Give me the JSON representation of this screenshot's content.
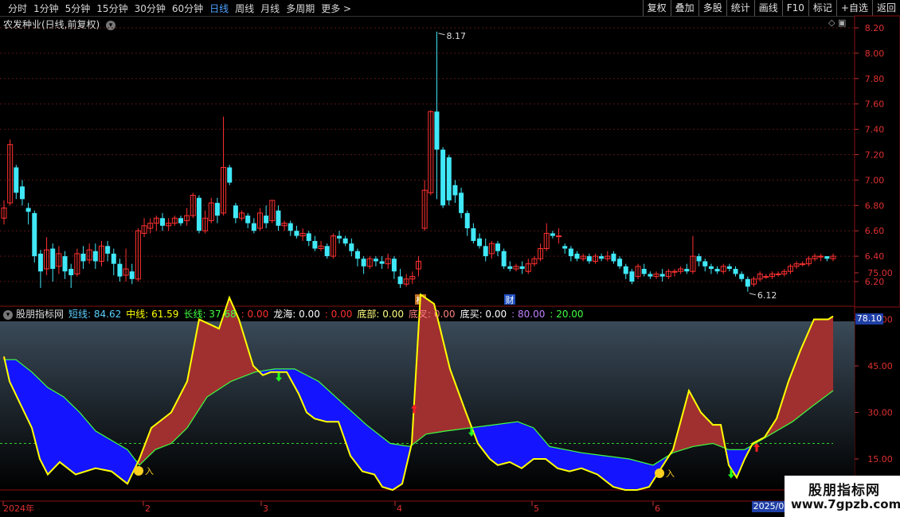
{
  "toolbar": {
    "periods": [
      "分时",
      "1分钟",
      "5分钟",
      "15分钟",
      "30分钟",
      "60分钟",
      "日线",
      "周线",
      "月线",
      "多周期",
      "更多 >"
    ],
    "active_period": "日线",
    "actions": [
      "复权",
      "叠加",
      "多股",
      "统计",
      "画线",
      "F10",
      "标记",
      "+自选",
      "返回"
    ]
  },
  "stock": {
    "title": "农发种业(日线,前复权)",
    "high_label": "8.17",
    "low_label": "6.12",
    "tags": [
      "榜",
      "财"
    ]
  },
  "price_axis": [
    "8.20",
    "8.00",
    "7.80",
    "7.60",
    "7.40",
    "7.20",
    "7.00",
    "6.80",
    "6.60",
    "6.40",
    "6.20"
  ],
  "indicator": {
    "name": "股朋指标网",
    "items": [
      {
        "label": "短线:",
        "value": "84.62",
        "color": "#5ad0ff"
      },
      {
        "label": "中线:",
        "value": "61.59",
        "color": "#ffff00"
      },
      {
        "label": "长线:",
        "value": "37.68",
        "color": "#40ff40"
      },
      {
        "label": ":",
        "value": "0.00",
        "color": "#ff3030"
      },
      {
        "label": "龙海:",
        "value": "0.00",
        "color": "#ffffff"
      },
      {
        "label": ":",
        "value": "0.00",
        "color": "#ff3030"
      },
      {
        "label": "底部:",
        "value": "0.00",
        "color": "#ffff80"
      },
      {
        "label": "底叉:",
        "value": "0.00",
        "color": "#ff8080"
      },
      {
        "label": "底买:",
        "value": "0.00",
        "color": "#ffffff"
      },
      {
        "label": ":",
        "value": "80.00",
        "color": "#c080ff"
      },
      {
        "label": ":",
        "value": "20.00",
        "color": "#40ff40"
      }
    ],
    "axis": [
      "75.00",
      "60.00",
      "45.00",
      "30.00",
      "15.00"
    ],
    "current_value": "78.10",
    "buy_label": "入"
  },
  "dates": {
    "labels": [
      "2024年",
      "2",
      "3",
      "4",
      "5",
      "6"
    ],
    "current": "2025/0"
  },
  "watermark": {
    "line1": "股朋指标网",
    "line2": "www.7gpzb.com"
  },
  "colors": {
    "bg": "#000000",
    "up": "#ff3030",
    "down": "#40e0f0",
    "fill_bull": "#a03030",
    "fill_bear": "#1010ff",
    "short": "#ffff00",
    "long": "#40ff40"
  }
}
